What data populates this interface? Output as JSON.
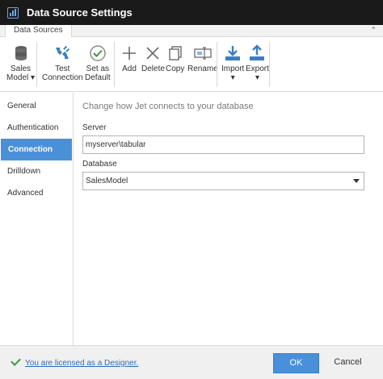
{
  "window": {
    "title": "Data Source Settings"
  },
  "tabstrip": {
    "tab_label": "Data Sources"
  },
  "ribbon": {
    "sales_model": {
      "line1": "Sales",
      "line2": "Model ▾"
    },
    "test_connection": {
      "line1": "Test",
      "line2": "Connection"
    },
    "set_default": {
      "line1": "Set as",
      "line2": "Default"
    },
    "add": "Add",
    "delete": "Delete",
    "copy": "Copy",
    "rename": "Rename",
    "import": {
      "line1": "Import",
      "line2": "▾"
    },
    "export": {
      "line1": "Export",
      "line2": "▾"
    }
  },
  "sidebar": {
    "items": [
      {
        "label": "General"
      },
      {
        "label": "Authentication"
      },
      {
        "label": "Connection"
      },
      {
        "label": "Drilldown"
      },
      {
        "label": "Advanced"
      }
    ],
    "active": "Connection"
  },
  "content": {
    "heading": "Change how Jet connects to your database",
    "server_label": "Server",
    "server_value": "myserver\\tabular",
    "database_label": "Database",
    "database_value": "SalesModel"
  },
  "footer": {
    "license_text": "You are licensed as a Designer.",
    "ok_label": "OK",
    "cancel_label": "Cancel"
  },
  "colors": {
    "accent": "#4a90d9",
    "titlebar": "#1a1a1a",
    "link": "#2a6cc0",
    "success": "#3a9a3a"
  },
  "icons": {
    "app": "jet-logo-icon",
    "collapse": "collapse-ribbon-icon",
    "sales_model": "database-icon",
    "test_connection": "plug-icon",
    "set_default": "check-circle-icon",
    "add": "plus-icon",
    "delete": "x-icon",
    "copy": "copy-icon",
    "rename": "rename-icon",
    "import": "download-icon",
    "export": "upload-icon",
    "license": "check-icon",
    "database_dropdown": "chevron-down-icon"
  }
}
